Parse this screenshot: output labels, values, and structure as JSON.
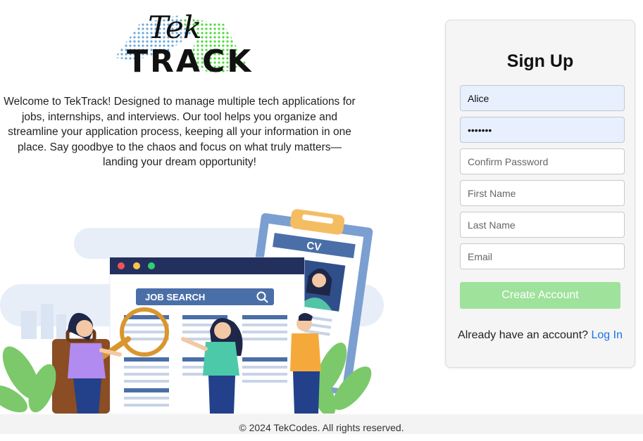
{
  "logo": {
    "top_text": "Tek",
    "bottom_text": "TRACK"
  },
  "intro": "Welcome to TekTrack! Designed to manage multiple tech applications for jobs, internships, and interviews. Our tool helps you organize and streamline your application process, keeping all your information in one place. Say goodbye to the chaos and focus on what truly matters—landing your dream opportunity!",
  "illustration": {
    "cv_label": "CV",
    "search_label": "JOB SEARCH"
  },
  "signup": {
    "title": "Sign Up",
    "username_value": "Alice",
    "password_value": "•••••••",
    "confirm_placeholder": "Confirm Password",
    "first_name_placeholder": "First Name",
    "last_name_placeholder": "Last Name",
    "email_placeholder": "Email",
    "create_button": "Create Account",
    "login_prompt": "Already have an account?",
    "login_link": "Log In"
  },
  "footer": "© 2024 TekCodes. All rights reserved.",
  "colors": {
    "accent_green": "#9ee29b",
    "link_blue": "#1a73e8",
    "navy": "#23305e"
  }
}
